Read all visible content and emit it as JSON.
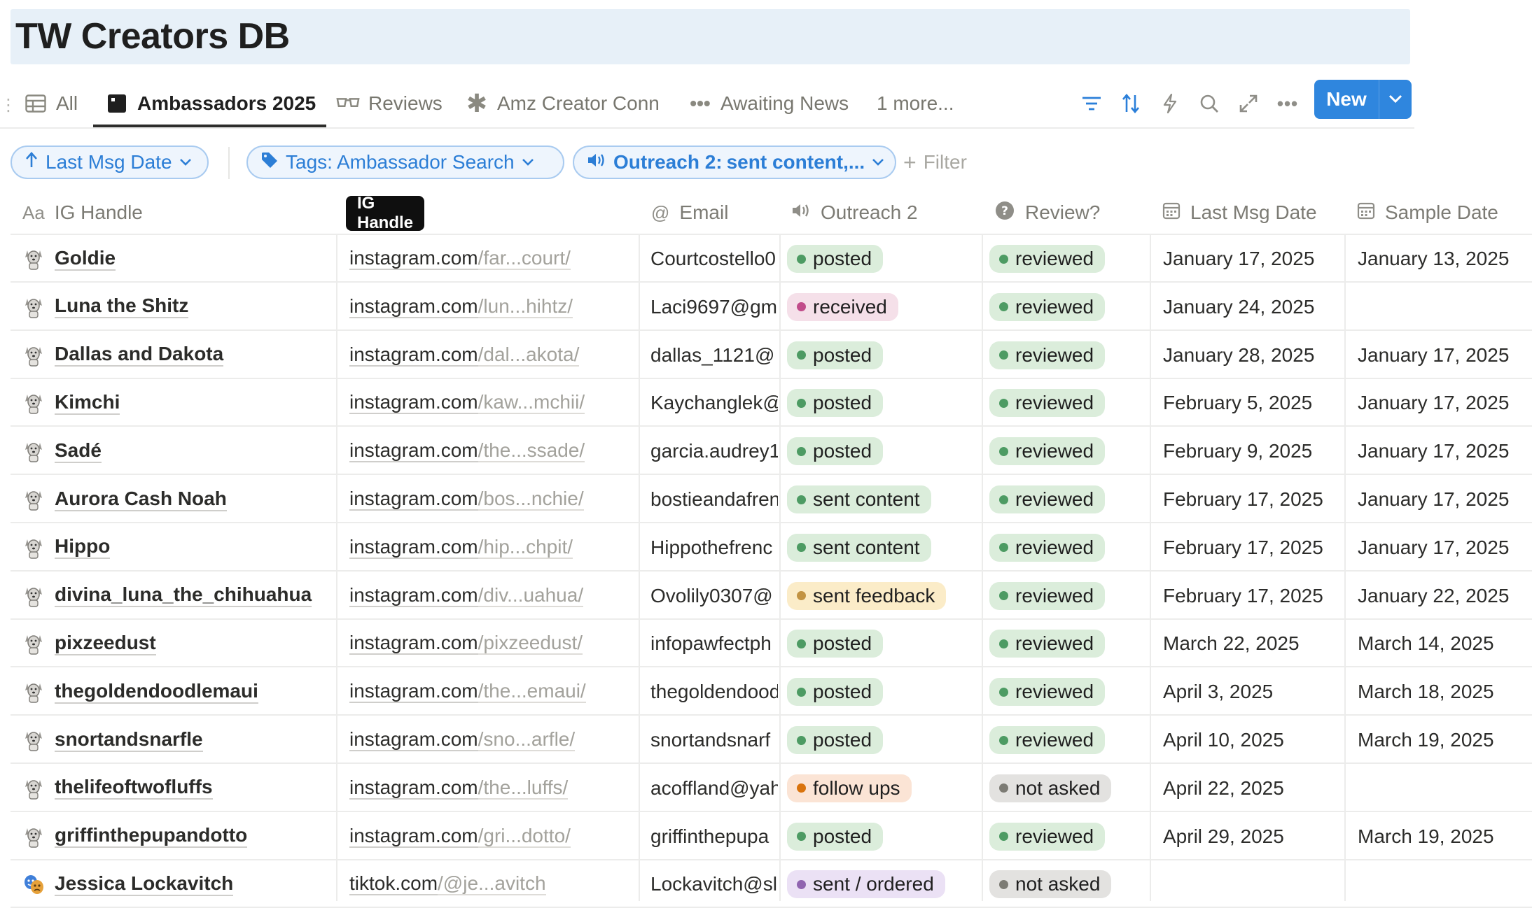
{
  "page": {
    "title": "TW Creators DB"
  },
  "views": {
    "tabs": [
      {
        "label": "All",
        "icon": "table-icon"
      },
      {
        "label": "Ambassadors 2025",
        "icon": "board-icon",
        "active": true
      },
      {
        "label": "Reviews",
        "icon": "glasses-icon"
      },
      {
        "label": "Amz Creator Conn",
        "icon": "asterisk-icon"
      },
      {
        "label": "Awaiting News",
        "icon": "more-dots-icon"
      }
    ],
    "more_label": "1 more...",
    "new_label": "New"
  },
  "filters": {
    "sort_chip": "Last Msg Date",
    "tags_chip_key": "Tags:",
    "tags_chip_value": "Ambassador Search",
    "outreach_chip_key": "Outreach 2:",
    "outreach_chip_value": "sent content,...",
    "add_filter_label": "Filter"
  },
  "columns": {
    "ig_handle": {
      "label": "IG Handle",
      "icon_text": "Aa"
    },
    "link": {
      "label": ""
    },
    "email": {
      "label": "Email",
      "icon_text": "@"
    },
    "outreach": {
      "label": "Outreach 2"
    },
    "review": {
      "label": "Review?"
    },
    "last_msg": {
      "label": "Last Msg Date"
    },
    "sample": {
      "label": "Sample Date"
    }
  },
  "tooltip": "IG Handle",
  "status_colors": {
    "posted": {
      "bg": "#dbeddb",
      "dot": "#4d9b63"
    },
    "received": {
      "bg": "#f5e0e9",
      "dot": "#c14c8a"
    },
    "sent content": {
      "bg": "#dbeddb",
      "dot": "#4d9b63"
    },
    "sent feedback": {
      "bg": "#fbecc8",
      "dot": "#c29343"
    },
    "follow ups": {
      "bg": "#fbe4d5",
      "dot": "#d9730d"
    },
    "sent / ordered": {
      "bg": "#ebe1f5",
      "dot": "#9065b0"
    },
    "reviewed": {
      "bg": "#dbeddb",
      "dot": "#4d9b63"
    },
    "not asked": {
      "bg": "#e3e2e0",
      "dot": "#7c7b74"
    }
  },
  "rows": [
    {
      "name": "Goldie",
      "avatar": "dog-icon",
      "link_domain": "instagram.com",
      "link_path": "/far...court/",
      "email": "Courtcostello0",
      "outreach": "posted",
      "review": "reviewed",
      "last_msg": "January 17, 2025",
      "sample": "January 13, 2025"
    },
    {
      "name": "Luna the Shitz",
      "avatar": "dog-icon",
      "link_domain": "instagram.com",
      "link_path": "/lun...hihtz/",
      "email": "Laci9697@gm",
      "outreach": "received",
      "review": "reviewed",
      "last_msg": "January 24, 2025",
      "sample": ""
    },
    {
      "name": "Dallas and Dakota",
      "avatar": "dog-icon",
      "link_domain": "instagram.com",
      "link_path": "/dal...akota/",
      "email": "dallas_1121@",
      "outreach": "posted",
      "review": "reviewed",
      "last_msg": "January 28, 2025",
      "sample": "January 17, 2025"
    },
    {
      "name": "Kimchi",
      "avatar": "dog-icon",
      "link_domain": "instagram.com",
      "link_path": "/kaw...mchii/",
      "email": "Kaychanglek@",
      "outreach": "posted",
      "review": "reviewed",
      "last_msg": "February 5, 2025",
      "sample": "January 17, 2025"
    },
    {
      "name": "Sadé",
      "avatar": "dog-icon",
      "link_domain": "instagram.com",
      "link_path": "/the...ssade/",
      "email": "garcia.audrey1",
      "outreach": "posted",
      "review": "reviewed",
      "last_msg": "February 9, 2025",
      "sample": "January 17, 2025"
    },
    {
      "name": "Aurora Cash Noah",
      "avatar": "dog-icon",
      "link_domain": "instagram.com",
      "link_path": "/bos...nchie/",
      "email": "bostieandafren",
      "outreach": "sent content",
      "review": "reviewed",
      "last_msg": "February 17, 2025",
      "sample": "January 17, 2025"
    },
    {
      "name": "Hippo",
      "avatar": "dog-icon",
      "link_domain": "instagram.com",
      "link_path": "/hip...chpit/",
      "email": "Hippothefrenc",
      "outreach": "sent content",
      "review": "reviewed",
      "last_msg": "February 17, 2025",
      "sample": "January 17, 2025"
    },
    {
      "name": "divina_luna_the_chihuahua",
      "avatar": "dog-icon",
      "link_domain": "instagram.com",
      "link_path": "/div...uahua/",
      "email": "Ovolily0307@",
      "outreach": "sent feedback",
      "review": "reviewed",
      "last_msg": "February 17, 2025",
      "sample": "January 22, 2025"
    },
    {
      "name": "pixzeedust",
      "avatar": "dog-icon",
      "link_domain": "instagram.com",
      "link_path": "/pixzeedust/",
      "email": "infopawfectph",
      "outreach": "posted",
      "review": "reviewed",
      "last_msg": "March 22, 2025",
      "sample": "March 14, 2025"
    },
    {
      "name": "thegoldendoodlemaui",
      "avatar": "dog-icon",
      "link_domain": "instagram.com",
      "link_path": "/the...emaui/",
      "email": "thegoldendood",
      "outreach": "posted",
      "review": "reviewed",
      "last_msg": "April 3, 2025",
      "sample": "March 18, 2025"
    },
    {
      "name": "snortandsnarfle",
      "avatar": "dog-icon",
      "link_domain": "instagram.com",
      "link_path": "/sno...arfle/",
      "email": "snortandsnarf",
      "outreach": "posted",
      "review": "reviewed",
      "last_msg": "April 10, 2025",
      "sample": "March 19, 2025"
    },
    {
      "name": "thelifeoftwofluffs",
      "avatar": "dog-icon",
      "link_domain": "instagram.com",
      "link_path": "/the...luffs/",
      "email": "acoffland@yah",
      "outreach": "follow ups",
      "review": "not asked",
      "last_msg": "April 22, 2025",
      "sample": ""
    },
    {
      "name": "griffinthepupandotto",
      "avatar": "dog-icon",
      "link_domain": "instagram.com",
      "link_path": "/gri...dotto/",
      "email": "griffinthepupa",
      "outreach": "posted",
      "review": "reviewed",
      "last_msg": "April 29, 2025",
      "sample": "March 19, 2025"
    },
    {
      "name": "Jessica Lockavitch",
      "avatar": "performer-icon",
      "link_domain": "tiktok.com",
      "link_path": "/@je...avitch",
      "email": "Lockavitch@sl",
      "outreach": "sent / ordered",
      "review": "not asked",
      "last_msg": "",
      "sample": ""
    }
  ]
}
